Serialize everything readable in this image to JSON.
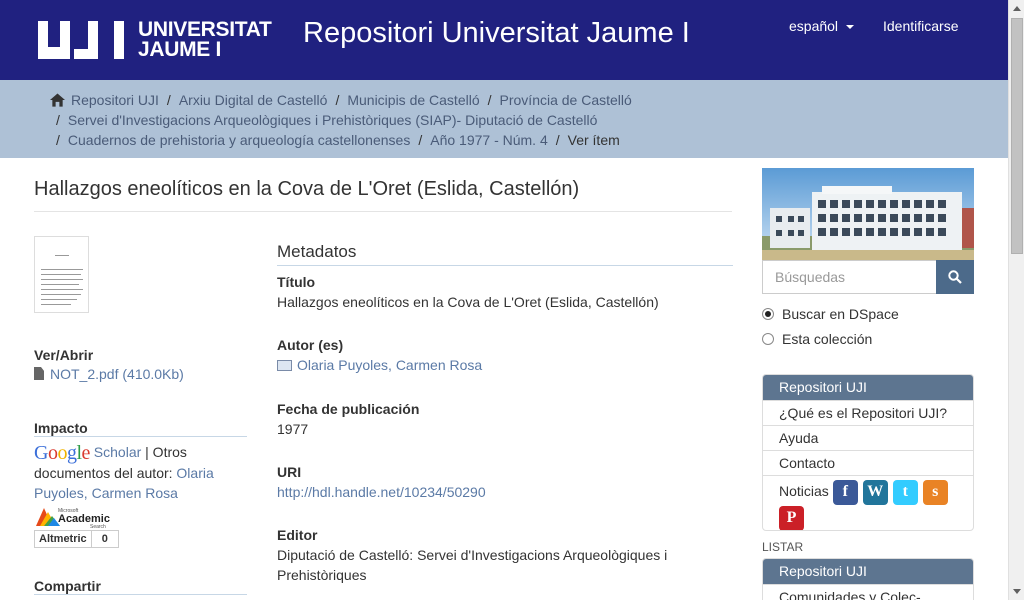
{
  "header": {
    "logo_text_line1": "UNIVERSITAT",
    "logo_text_line2": "JAUME I",
    "site_title": "Repositori Universitat Jaume I",
    "language": "español",
    "login": "Identificarse",
    "bg_color": "#202180"
  },
  "breadcrumb": {
    "items": [
      "Repositori UJI",
      "Arxiu Digital de Castelló",
      "Municipis de Castelló",
      "Província de Castelló",
      "Servei d'Investigacions Arqueològiques i Prehistòriques (SIAP)- Diputació de Castelló",
      "Cuadernos de prehistoria y arqueología castellonenses",
      "Año 1977 - Núm. 4"
    ],
    "current": "Ver ítem"
  },
  "item": {
    "title": "Hallazgos eneolíticos en la Cova de L'Oret (Eslida, Castellón)"
  },
  "left": {
    "view_open_heading": "Ver/Abrir",
    "file_link": "NOT_2.pdf (410.0Kb)",
    "impact_heading": "Impacto",
    "google_word": "Google",
    "scholar_link": "Scholar",
    "other_docs_prefix": "| Otros documentos del autor:",
    "author_link": "Olaria Puyoles, Carmen Rosa",
    "academic_label": "Academic",
    "academic_sub": "Search",
    "academic_brand": "Microsoft",
    "altmetric_label": "Altmetric",
    "altmetric_score": "0",
    "share_heading": "Compartir"
  },
  "metadata": {
    "heading": "Metadatos",
    "fields": [
      {
        "label": "Título",
        "value": "Hallazgos eneolíticos en la Cova de L'Oret (Eslida, Castellón)"
      },
      {
        "label": "Autor (es)",
        "value": "Olaria Puyoles, Carmen Rosa"
      },
      {
        "label": "Fecha de publicación",
        "value": "1977"
      },
      {
        "label": "URI",
        "value": "http://hdl.handle.net/10234/50290"
      },
      {
        "label": "Editor",
        "value": "Diputació de Castelló: Servei d'Investigacions Arqueològiques i Prehistòriques"
      }
    ]
  },
  "sidebar": {
    "search_placeholder": "Búsquedas",
    "radio_dspace": "Buscar en DSpace",
    "radio_collection": "Esta colección",
    "panel1_head": "Repositori UJI",
    "panel1_items": [
      "¿Qué es el Repositori UJI?",
      "Ayuda",
      "Contacto",
      "Noticias"
    ],
    "social_icons": [
      "facebook-icon",
      "wordpress-icon",
      "twitter-icon",
      "slideshare-icon",
      "pinterest-icon"
    ],
    "listar": "LISTAR",
    "panel2_head": "Repositori UJI",
    "panel2_first": "Comunidades y Colec-"
  }
}
